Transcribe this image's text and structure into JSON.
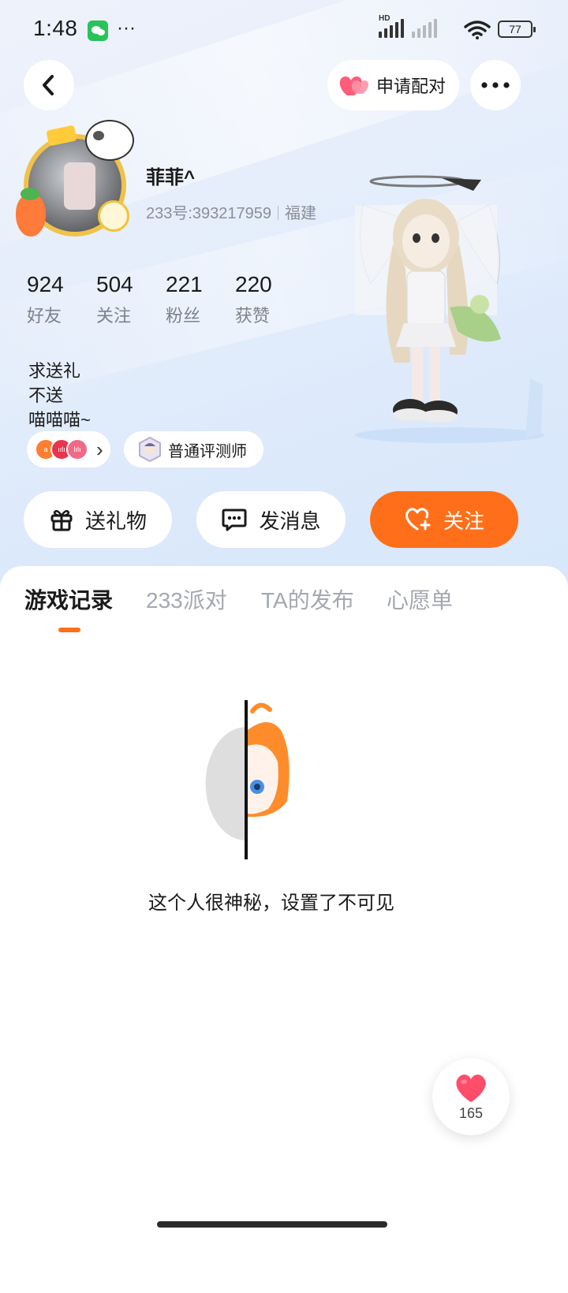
{
  "status_bar": {
    "time": "1:48",
    "more": "···",
    "hd": "HD",
    "battery": "77"
  },
  "header": {
    "match_label": "申请配对"
  },
  "profile": {
    "name": "菲菲^",
    "uid": "233号:393217959",
    "region": "福建",
    "stats": [
      {
        "value": "924",
        "label": "好友"
      },
      {
        "value": "504",
        "label": "关注"
      },
      {
        "value": "221",
        "label": "粉丝"
      },
      {
        "value": "220",
        "label": "获赞"
      }
    ],
    "bio_lines": [
      "求送礼",
      "不送",
      "喵喵喵~"
    ],
    "badges": {
      "chevron": "›",
      "mini": [
        "a",
        "ıılı",
        "lılı"
      ],
      "tester_label": "普通评测师"
    }
  },
  "actions": {
    "gift": "送礼物",
    "message": "发消息",
    "follow": "关注"
  },
  "tabs": [
    "游戏记录",
    "233派对",
    "TA的发布",
    "心愿单"
  ],
  "empty_state": {
    "text": "这个人很神秘，设置了不可见"
  },
  "like_fab": {
    "count": "165"
  },
  "colors": {
    "accent": "#ff6f1a",
    "heart": "#ff4d6a",
    "muted": "#8b8f98"
  },
  "icons": [
    "back-icon",
    "heart-pair-icon",
    "more-icon",
    "gift-icon",
    "message-icon",
    "heart-plus-icon",
    "heart-icon",
    "wifi-icon",
    "signal-icon",
    "battery-icon",
    "wechat-icon"
  ]
}
